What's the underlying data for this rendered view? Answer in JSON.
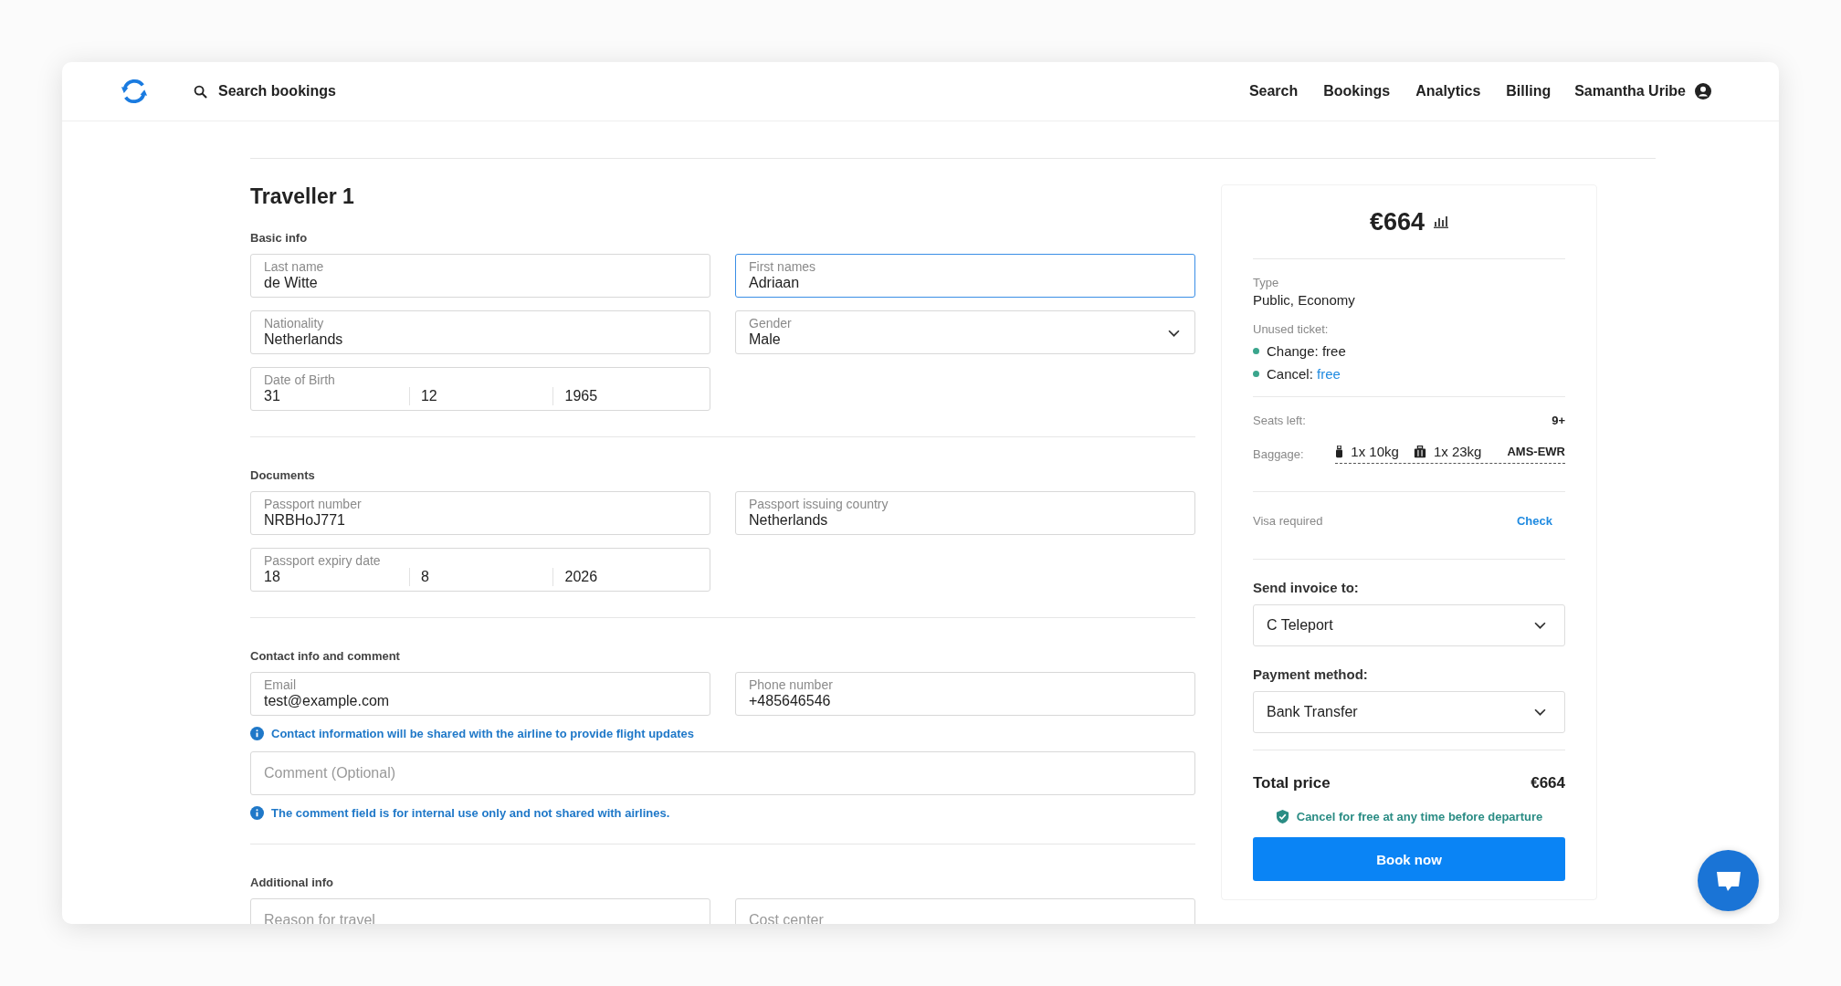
{
  "header": {
    "search_label": "Search bookings",
    "nav": [
      "Search",
      "Bookings",
      "Analytics",
      "Billing"
    ],
    "user": "Samantha Uribe"
  },
  "form": {
    "title": "Traveller 1",
    "sections": [
      {
        "title": "Basic info",
        "items": [
          {
            "kind": "text",
            "label": "Last name",
            "value": "de Witte",
            "focused": false
          },
          {
            "kind": "text",
            "label": "First names",
            "value": "Adriaan",
            "focused": true
          },
          {
            "kind": "text",
            "label": "Nationality",
            "value": "Netherlands",
            "focused": false
          },
          {
            "kind": "select",
            "label": "Gender",
            "value": "Male"
          },
          {
            "kind": "date",
            "label": "Date of Birth",
            "parts": [
              "31",
              "12",
              "1965"
            ]
          }
        ]
      },
      {
        "title": "Documents",
        "items": [
          {
            "kind": "text",
            "label": "Passport number",
            "value": "NRBHoJ771",
            "focused": false
          },
          {
            "kind": "text",
            "label": "Passport issuing country",
            "value": "Netherlands",
            "focused": false
          },
          {
            "kind": "date",
            "label": "Passport expiry date",
            "parts": [
              "18",
              "8",
              "2026"
            ]
          }
        ]
      },
      {
        "title": "Contact info and comment",
        "items": [
          {
            "kind": "text",
            "label": "Email",
            "value": "test@example.com",
            "focused": false
          },
          {
            "kind": "text",
            "label": "Phone number",
            "value": "+485646546",
            "focused": false
          },
          {
            "kind": "note",
            "text": "Contact information will be shared with the airline to provide flight updates"
          },
          {
            "kind": "comment",
            "placeholder": "Comment (Optional)"
          },
          {
            "kind": "note",
            "text": "The comment field is for internal use only and not shared with airlines."
          }
        ]
      },
      {
        "title": "Additional info",
        "items": [
          {
            "kind": "empty",
            "placeholder": "Reason for travel"
          },
          {
            "kind": "empty",
            "placeholder": "Cost center"
          }
        ]
      }
    ]
  },
  "summary": {
    "price": "€664",
    "type_label": "Type",
    "type_value": "Public, Economy",
    "unused_label": "Unused ticket:",
    "conditions": [
      {
        "label": "Change:",
        "value": "free",
        "link": false,
        "color": "#3aa58c"
      },
      {
        "label": "Cancel:",
        "value": "free",
        "link": true,
        "color": "#3aa58c"
      }
    ],
    "seats_label": "Seats left:",
    "seats_value": "9+",
    "baggage_label": "Baggage:",
    "baggage": [
      {
        "kind": "cabin",
        "text": "1x 10kg"
      },
      {
        "kind": "checked",
        "text": "1x 23kg"
      }
    ],
    "route": "AMS-EWR",
    "visa_label": "Visa required",
    "visa_link": "Check",
    "invoice_label": "Send invoice to:",
    "invoice_value": "C Teleport",
    "payment_label": "Payment method:",
    "payment_value": "Bank Transfer",
    "total_label": "Total price",
    "total_value": "€664",
    "guarantee": "Cancel for free at any time before departure",
    "book_button": "Book now"
  }
}
